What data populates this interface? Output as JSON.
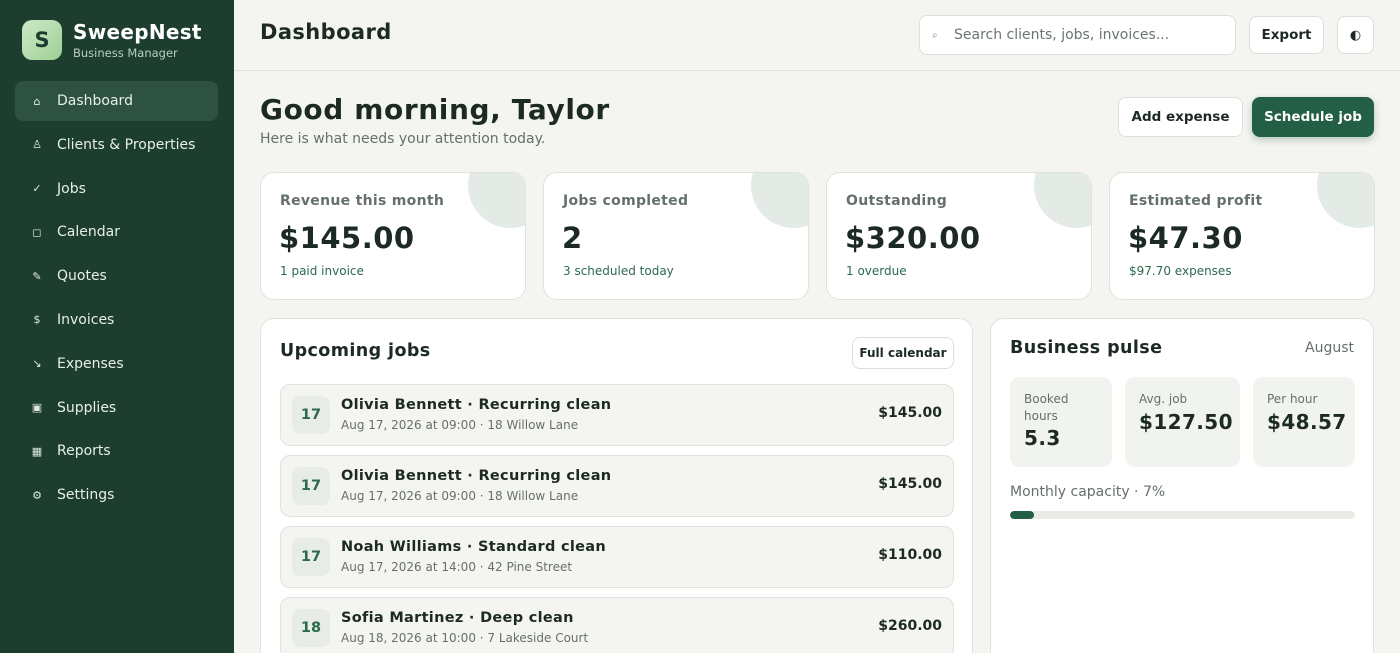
{
  "brand": {
    "logo_letter": "S",
    "name": "SweepNest",
    "subtitle": "Business Manager"
  },
  "sidebar": {
    "items": [
      {
        "label": "Dashboard",
        "icon": "home-icon",
        "glyph": "⌂",
        "active": true
      },
      {
        "label": "Clients & Properties",
        "icon": "person-icon",
        "glyph": "♙"
      },
      {
        "label": "Jobs",
        "icon": "check-icon",
        "glyph": "✓"
      },
      {
        "label": "Calendar",
        "icon": "calendar-icon",
        "glyph": "◻"
      },
      {
        "label": "Quotes",
        "icon": "pencil-icon",
        "glyph": "✎"
      },
      {
        "label": "Invoices",
        "icon": "dollar-icon",
        "glyph": "$"
      },
      {
        "label": "Expenses",
        "icon": "arrow-down-right-icon",
        "glyph": "↘"
      },
      {
        "label": "Supplies",
        "icon": "box-icon",
        "glyph": "▣"
      },
      {
        "label": "Reports",
        "icon": "report-icon",
        "glyph": "▦"
      },
      {
        "label": "Settings",
        "icon": "gear-icon",
        "glyph": "⚙"
      }
    ]
  },
  "header": {
    "title": "Dashboard",
    "search_placeholder": "Search clients, jobs, invoices...",
    "search_icon": "⌕",
    "export_label": "Export",
    "theme_icon": "◐"
  },
  "greeting": {
    "title": "Good morning, Taylor",
    "subtitle": "Here is what needs your attention today.",
    "add_expense_label": "Add expense",
    "schedule_job_label": "Schedule job"
  },
  "stats": [
    {
      "label": "Revenue this month",
      "value": "$145.00",
      "note": "1 paid invoice"
    },
    {
      "label": "Jobs completed",
      "value": "2",
      "note": "3 scheduled today"
    },
    {
      "label": "Outstanding",
      "value": "$320.00",
      "note": "1 overdue"
    },
    {
      "label": "Estimated profit",
      "value": "$47.30",
      "note": "$97.70 expenses"
    }
  ],
  "upcoming": {
    "title": "Upcoming jobs",
    "calendar_button": "Full calendar",
    "jobs": [
      {
        "day": "17",
        "title": "Olivia Bennett · Recurring clean",
        "details": "Aug 17, 2026 at 09:00 · 18 Willow Lane",
        "price": "$145.00"
      },
      {
        "day": "17",
        "title": "Olivia Bennett · Recurring clean",
        "details": "Aug 17, 2026 at 09:00 · 18 Willow Lane",
        "price": "$145.00"
      },
      {
        "day": "17",
        "title": "Noah Williams · Standard clean",
        "details": "Aug 17, 2026 at 14:00 · 42 Pine Street",
        "price": "$110.00"
      },
      {
        "day": "18",
        "title": "Sofia Martinez · Deep clean",
        "details": "Aug 18, 2026 at 10:00 · 7 Lakeside Court",
        "price": "$260.00"
      }
    ]
  },
  "pulse": {
    "title": "Business pulse",
    "month": "August",
    "metrics": [
      {
        "label_line1": "Booked",
        "label_line2": "hours",
        "value": "5.3"
      },
      {
        "label_line1": "Avg. job",
        "label_line2": "",
        "value": "$127.50"
      },
      {
        "label_line1": "Per hour",
        "label_line2": "",
        "value": "$48.57"
      }
    ],
    "capacity_label": "Monthly capacity · 7%",
    "capacity_percent": 7
  },
  "colors": {
    "sidebar": "#1d3d2f",
    "accent": "#235f45",
    "background": "#f4f5f0"
  }
}
